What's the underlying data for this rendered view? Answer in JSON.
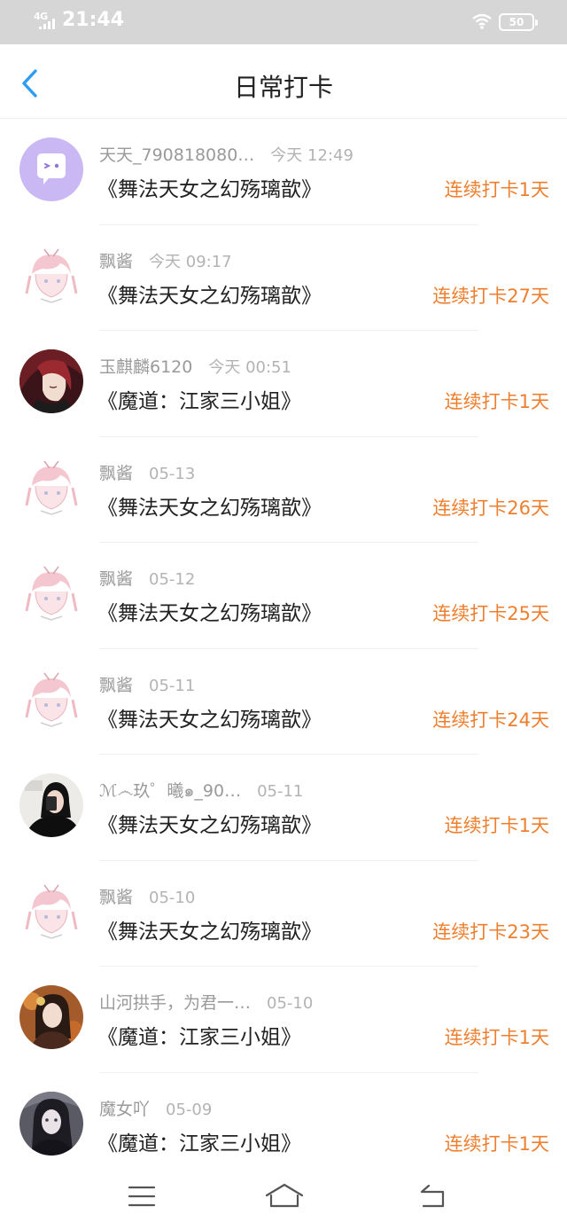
{
  "status_bar": {
    "network": "4G",
    "time": "21:44",
    "battery": "50"
  },
  "header": {
    "title": "日常打卡"
  },
  "checkins": [
    {
      "user": "天天_790818080…",
      "time": "今天 12:49",
      "book": "《舞法天女之幻殇璃歆》",
      "streak": "连续打卡1天",
      "avatar": "ghost-avatar"
    },
    {
      "user": "飘酱",
      "time": "今天 09:17",
      "book": "《舞法天女之幻殇璃歆》",
      "streak": "连续打卡27天",
      "avatar": "pink-anime-avatar"
    },
    {
      "user": "玉麒麟6120",
      "time": "今天 00:51",
      "book": "《魔道：江家三小姐》",
      "streak": "连续打卡1天",
      "avatar": "dark-red-illustration-avatar"
    },
    {
      "user": "飘酱",
      "time": "05-13",
      "book": "《舞法天女之幻殇璃歆》",
      "streak": "连续打卡26天",
      "avatar": "pink-anime-avatar"
    },
    {
      "user": "飘酱",
      "time": "05-12",
      "book": "《舞法天女之幻殇璃歆》",
      "streak": "连续打卡25天",
      "avatar": "pink-anime-avatar"
    },
    {
      "user": "飘酱",
      "time": "05-11",
      "book": "《舞法天女之幻殇璃歆》",
      "streak": "连续打卡24天",
      "avatar": "pink-anime-avatar"
    },
    {
      "user": "ℳ෴玖゜曦๑_90…",
      "time": "05-11",
      "book": "《舞法天女之幻殇璃歆》",
      "streak": "连续打卡1天",
      "avatar": "selfie-photo-avatar"
    },
    {
      "user": "飘酱",
      "time": "05-10",
      "book": "《舞法天女之幻殇璃歆》",
      "streak": "连续打卡23天",
      "avatar": "pink-anime-avatar"
    },
    {
      "user": "山河拱手，为君一…",
      "time": "05-10",
      "book": "《魔道：江家三小姐》",
      "streak": "连续打卡1天",
      "avatar": "costume-girl-avatar"
    },
    {
      "user": "魔女吖",
      "time": "05-09",
      "book": "《魔道：江家三小姐》",
      "streak": "连续打卡1天",
      "avatar": "gothic-girl-avatar"
    }
  ],
  "colors": {
    "accent": "#ee7f2f",
    "back_arrow": "#2d9cf5",
    "status_bar": "#d6d6d6"
  }
}
